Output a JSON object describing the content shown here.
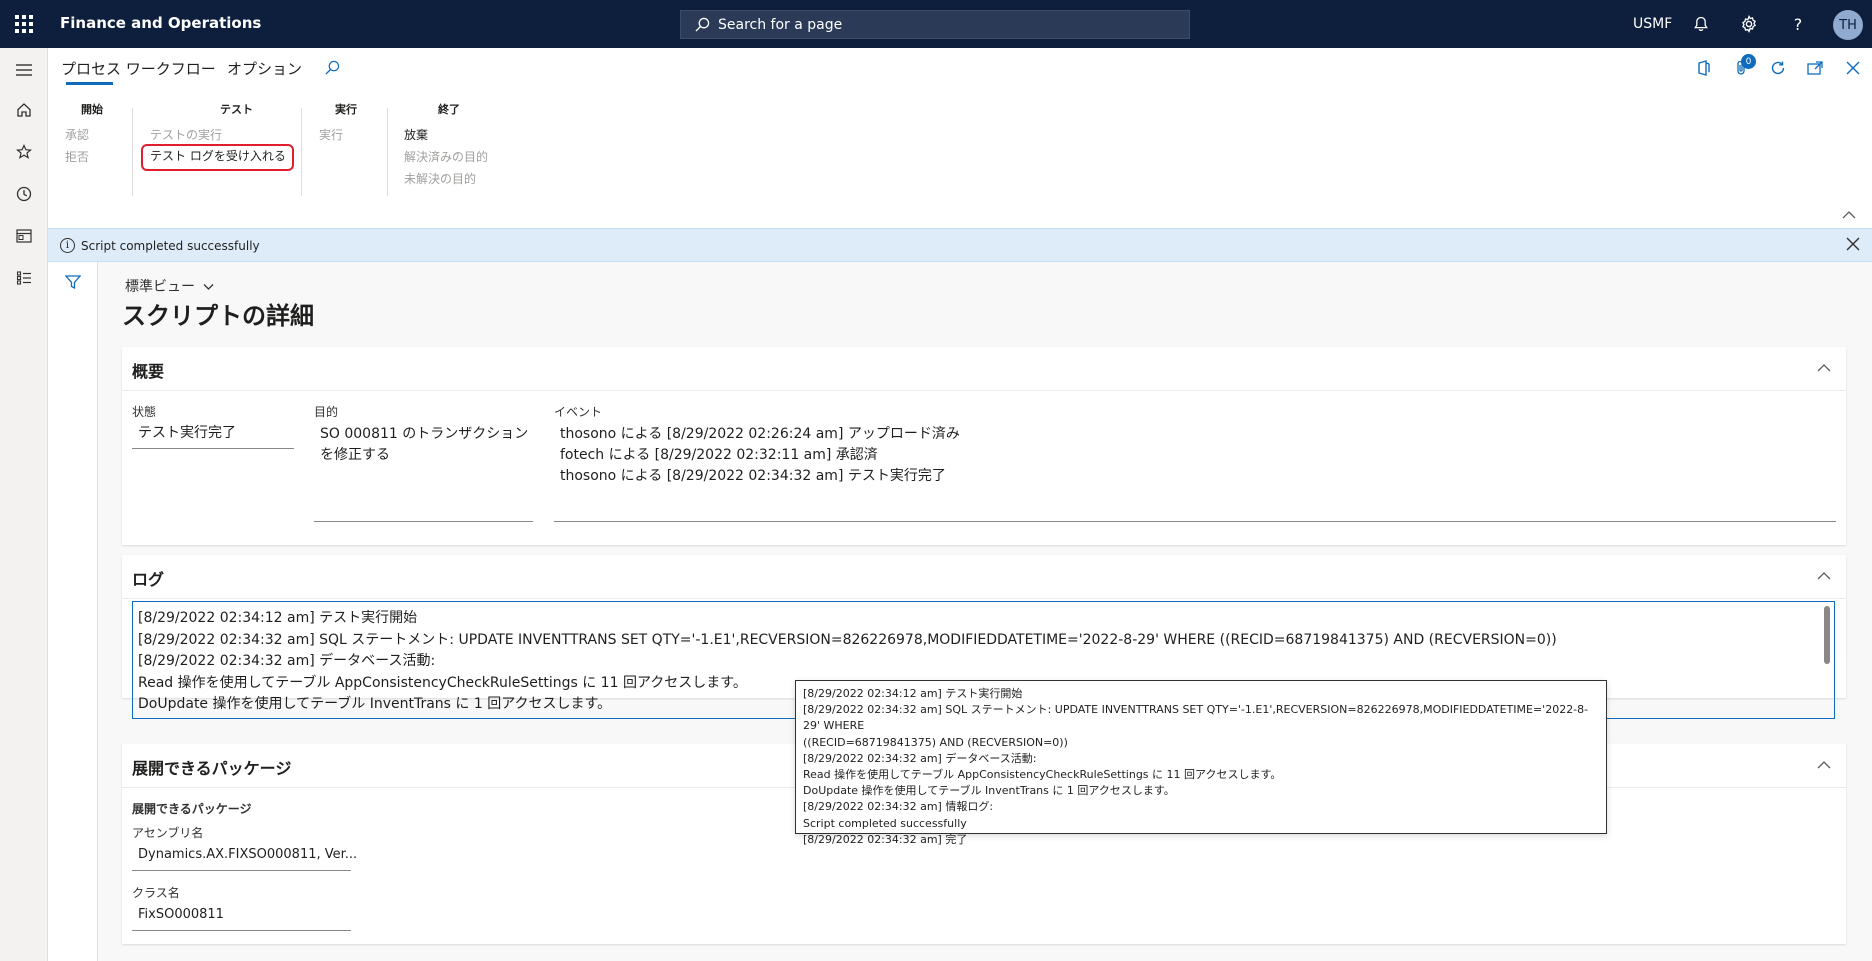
{
  "app": {
    "title": "Finance and Operations",
    "company": "USMF",
    "avatar_initials": "TH"
  },
  "search": {
    "placeholder": "Search for a page"
  },
  "ribbon": {
    "tabs": [
      "プロセス ワークフロー",
      "オプション"
    ],
    "groups": [
      {
        "title": "開始",
        "items": [
          {
            "label": "承認",
            "enabled": false
          },
          {
            "label": "拒否",
            "enabled": false
          }
        ]
      },
      {
        "title": "テスト",
        "items": [
          {
            "label": "テストの実行",
            "enabled": false
          },
          {
            "label": "テスト ログを受け入れる",
            "enabled": true
          }
        ]
      },
      {
        "title": "実行",
        "items": [
          {
            "label": "実行",
            "enabled": false
          }
        ]
      },
      {
        "title": "終了",
        "items": [
          {
            "label": "放棄",
            "enabled": true
          },
          {
            "label": "解決済みの目的",
            "enabled": false
          },
          {
            "label": "未解決の目的",
            "enabled": false
          }
        ]
      }
    ],
    "notification_count": "0"
  },
  "message": {
    "text": "Script completed successfully"
  },
  "page": {
    "view": "標準ビュー",
    "title": "スクリプトの詳細"
  },
  "overview": {
    "title": "概要",
    "status_label": "状態",
    "status_value": "テスト実行完了",
    "purpose_label": "目的",
    "purpose_line1": "SO 000811 のトランザクション",
    "purpose_line2": "を修正する",
    "events_label": "イベント",
    "events": [
      "thosono による [8/29/2022 02:26:24 am] アップロード済み",
      "fotech による [8/29/2022 02:32:11 am] 承認済",
      "thosono による [8/29/2022 02:34:32 am] テスト実行完了"
    ]
  },
  "log": {
    "title": "ログ",
    "lines": [
      "[8/29/2022 02:34:12 am] テスト実行開始",
      "[8/29/2022 02:34:32 am] SQL ステートメント: UPDATE INVENTTRANS SET QTY='-1.E1',RECVERSION=826226978,MODIFIEDDATETIME='2022-8-29' WHERE ((RECID=68719841375) AND (RECVERSION=0))",
      "[8/29/2022 02:34:32 am] データベース活動:",
      "Read 操作を使用してテーブル AppConsistencyCheckRuleSettings に 11 回アクセスします。",
      "DoUpdate 操作を使用してテーブル InventTrans に 1 回アクセスします。"
    ]
  },
  "tooltip": {
    "lines": [
      "[8/29/2022 02:34:12 am] テスト実行開始",
      "[8/29/2022 02:34:32 am] SQL ステートメント: UPDATE INVENTTRANS SET QTY='-1.E1',RECVERSION=826226978,MODIFIEDDATETIME='2022-8-29' WHERE",
      "((RECID=68719841375) AND (RECVERSION=0))",
      "[8/29/2022 02:34:32 am] データベース活動:",
      "Read 操作を使用してテーブル AppConsistencyCheckRuleSettings に 11 回アクセスします。",
      "DoUpdate 操作を使用してテーブル InventTrans に 1 回アクセスします。",
      "[8/29/2022 02:34:32 am] 情報ログ:",
      "Script completed successfully",
      "[8/29/2022 02:34:32 am] 完了"
    ]
  },
  "packages": {
    "title": "展開できるパッケージ",
    "group_label": "展開できるパッケージ",
    "assembly_label": "アセンブリ名",
    "assembly_value": "Dynamics.AX.FIXSO000811, Ver...",
    "class_label": "クラス名",
    "class_value": "FixSO000811"
  }
}
